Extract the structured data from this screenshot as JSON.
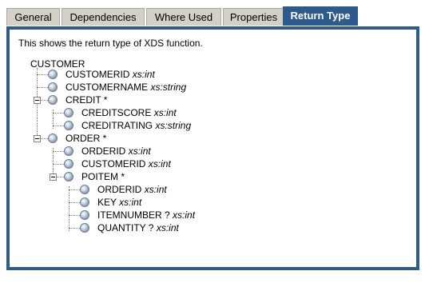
{
  "tabs": [
    {
      "label": "General"
    },
    {
      "label": "Dependencies"
    },
    {
      "label": "Where Used"
    },
    {
      "label": "Properties"
    },
    {
      "label": "Return Type",
      "active": true
    }
  ],
  "description": "This shows the return type of XDS function.",
  "tree": {
    "root": "CUSTOMER",
    "nodes": [
      {
        "name": "CUSTOMERID",
        "type": "xs:int"
      },
      {
        "name": "CUSTOMERNAME",
        "type": "xs:string"
      },
      {
        "name": "CREDIT *",
        "type": "",
        "expanded": true
      },
      {
        "name": "CREDITSCORE",
        "type": "xs:int"
      },
      {
        "name": "CREDITRATING",
        "type": "xs:string"
      },
      {
        "name": "ORDER *",
        "type": "",
        "expanded": true
      },
      {
        "name": "ORDERID",
        "type": "xs:int"
      },
      {
        "name": "CUSTOMERID",
        "type": "xs:int"
      },
      {
        "name": "POITEM *",
        "type": "",
        "expanded": true
      },
      {
        "name": "ORDERID",
        "type": "xs:int"
      },
      {
        "name": "KEY",
        "type": "xs:int"
      },
      {
        "name": "ITEMNUMBER ?",
        "type": "xs:int"
      },
      {
        "name": "QUANTITY ?",
        "type": "xs:int"
      }
    ]
  },
  "colors": {
    "accent": "#2f5a8c",
    "tab_bg": "#d4d0c8"
  },
  "icons": {
    "node": "tree-node-ball-icon",
    "collapse": "collapse-minus-icon"
  }
}
